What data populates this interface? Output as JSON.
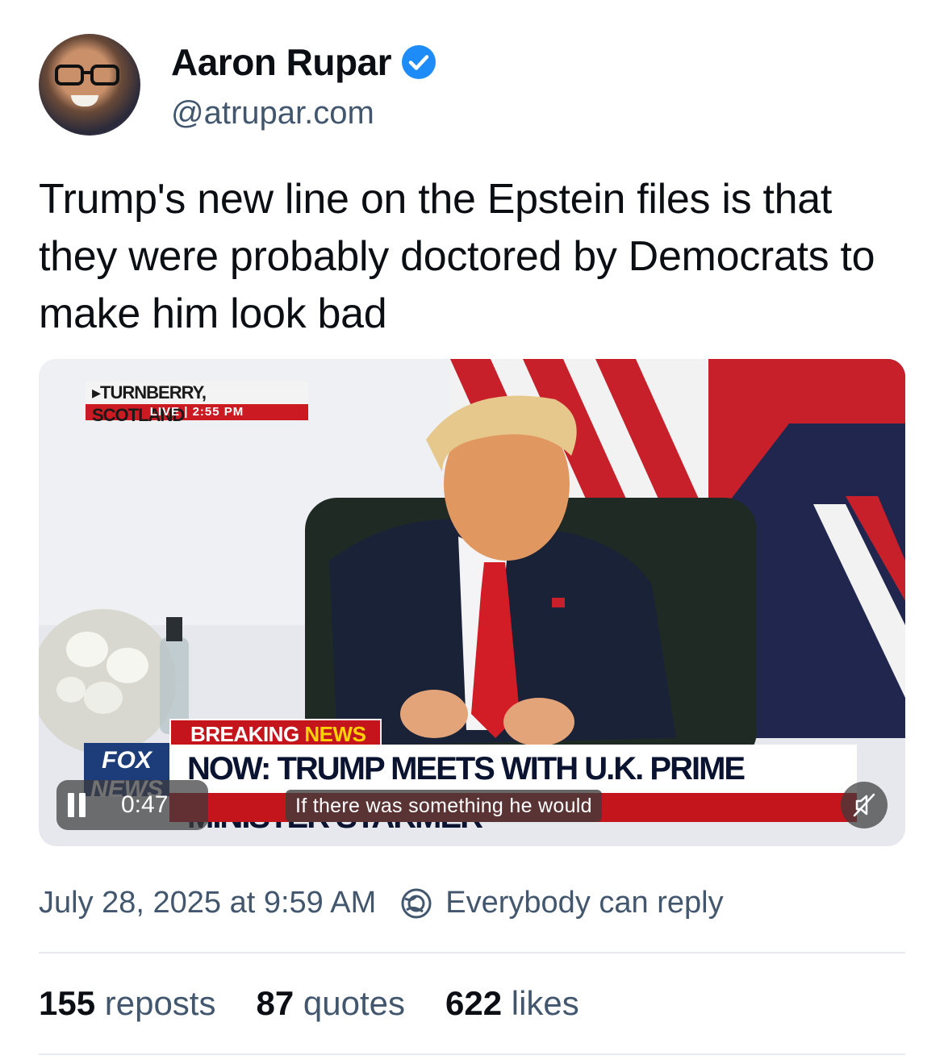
{
  "author": {
    "name": "Aaron Rupar",
    "handle": "@atrupar.com",
    "verified_color": "#1d8cf8"
  },
  "post": {
    "text": "Trump's new line on the Epstein files is that they were probably doctored by Democrats to make him look bad"
  },
  "video": {
    "location": "TURNBERRY, SCOTLAND",
    "live_label": "LIVE",
    "live_time": "2:55 PM",
    "breaking_label": "BREAKING",
    "breaking_accent": "NEWS",
    "headline": "NOW: TRUMP MEETS WITH U.K. PRIME MINISTER STARMER",
    "network_logo": "FOX NEWS",
    "elapsed": "0:47",
    "caption": "If there was something he would",
    "icons": {
      "play": "pause-icon",
      "sound": "mute-icon"
    }
  },
  "meta": {
    "timestamp": "July 28, 2025 at 9:59 AM",
    "reply_setting": "Everybody can reply"
  },
  "stats": {
    "reposts_count": "155",
    "reposts_label": "reposts",
    "quotes_count": "87",
    "quotes_label": "quotes",
    "likes_count": "622",
    "likes_label": "likes"
  }
}
